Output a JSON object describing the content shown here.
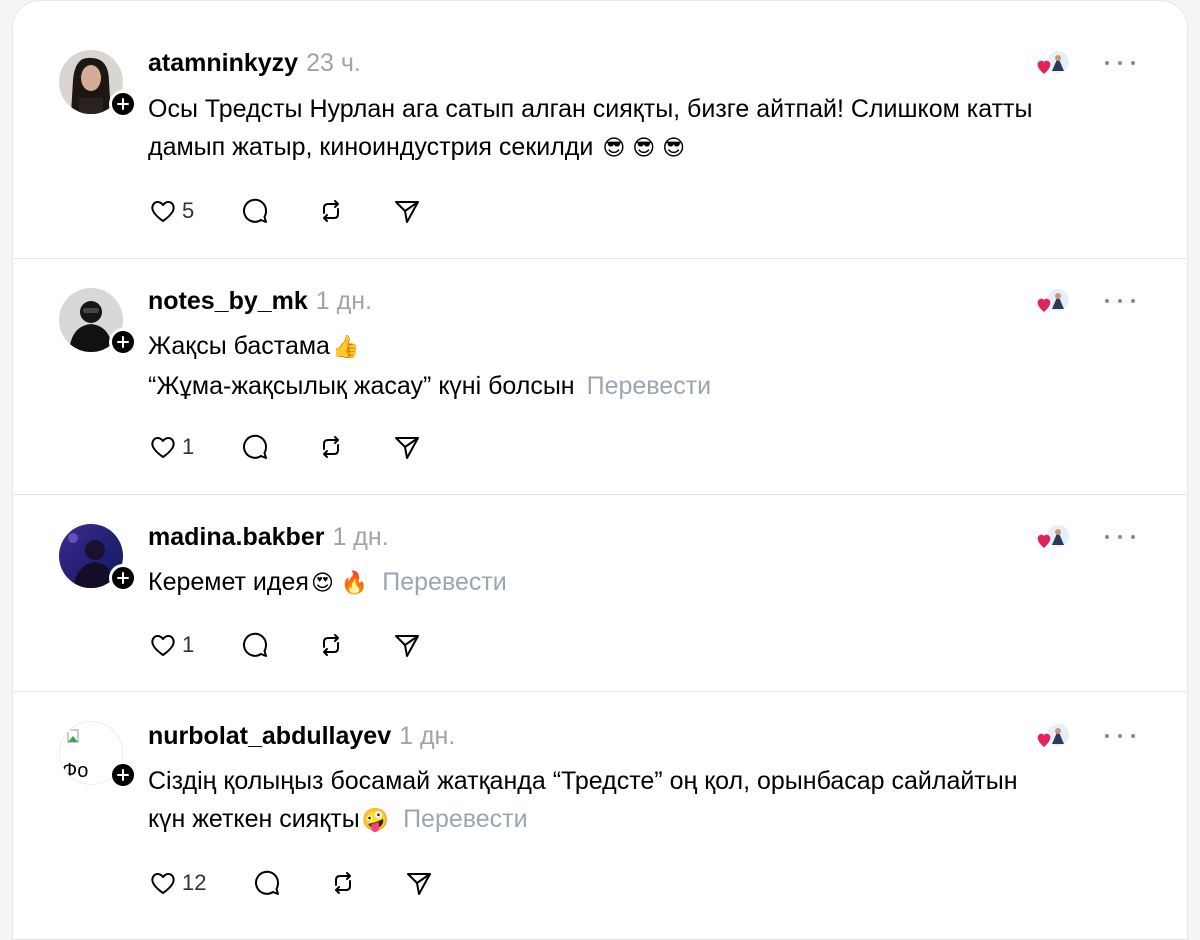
{
  "posts": [
    {
      "username": "atamninkyzy",
      "time": "23 ч.",
      "lines": [
        "Осы Тредсты Нурлан ага сатып алган сияқты, бизге айтпай! Слишком катты",
        "дамып жатыр, киноиндустрия секилди"
      ],
      "emojis": "😎 😎 😎",
      "translate": "",
      "likes": "5",
      "avatar_icon": "user-avatar-dark-hair"
    },
    {
      "username": "notes_by_mk",
      "time": "1 дн.",
      "lines": [
        "Жақсы бастама",
        "“Жұма-жақсылық жасау” күні болсын"
      ],
      "emojis": "👍",
      "translate": "Перевести",
      "likes": "1",
      "avatar_icon": "user-avatar-dark-figure"
    },
    {
      "username": "madina.bakber",
      "time": "1 дн.",
      "lines": [
        "Керемет идея"
      ],
      "emojis": "😍 🔥",
      "translate": "Перевести",
      "likes": "1",
      "avatar_icon": "user-avatar-purple-blue"
    },
    {
      "username": "nurbolat_abdullayev",
      "time": "1 дн.",
      "lines": [
        "Сіздің қолыңыз босамай жатқанда “Тредсте” оң қол, орынбасар сайлайтын",
        "күн жеткен сияқты"
      ],
      "emojis": "🤪",
      "translate": "Перевести",
      "likes": "12",
      "avatar_icon": "broken-image-avatar",
      "avatar_alt": "Фо"
    }
  ],
  "colors": {
    "meta": "#a3a3a3",
    "translate": "#9aa6b2",
    "heart": "#e0245e"
  }
}
